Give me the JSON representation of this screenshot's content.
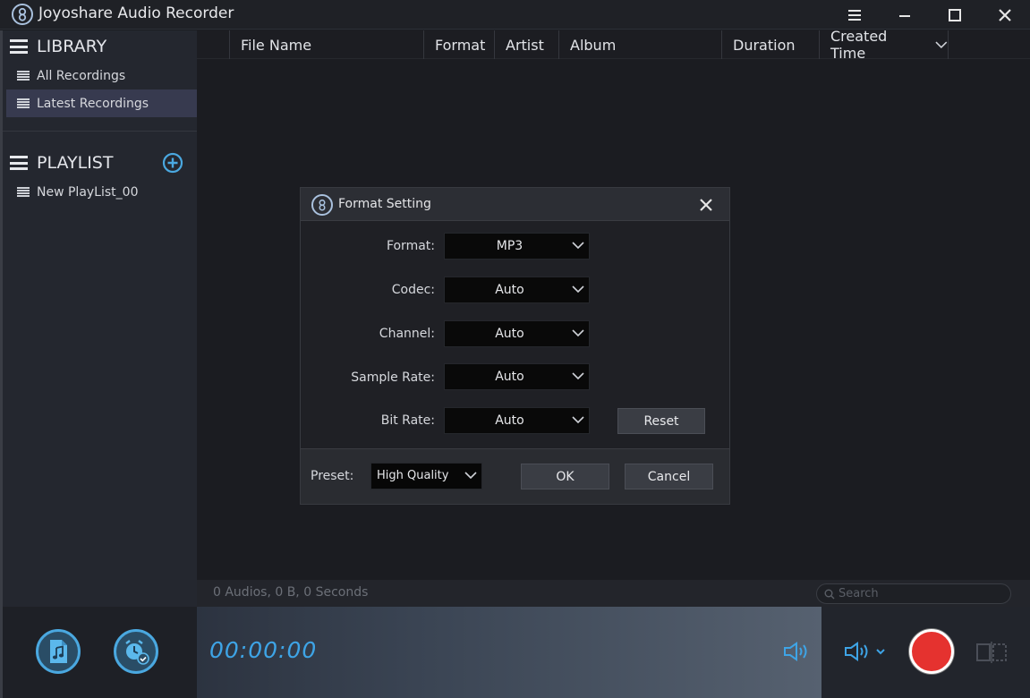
{
  "app": {
    "title": "Joyoshare Audio Recorder"
  },
  "sidebar": {
    "library_title": "LIBRARY",
    "library_items": [
      {
        "label": "All Recordings",
        "active": false
      },
      {
        "label": "Latest Recordings",
        "active": true
      }
    ],
    "playlist_title": "PLAYLIST",
    "playlist_items": [
      {
        "label": "New PlayList_00"
      }
    ]
  },
  "table": {
    "columns": [
      "File Name",
      "Format",
      "Artist",
      "Album",
      "Duration",
      "Created Time"
    ],
    "rows": []
  },
  "status": {
    "summary": "0 Audios, 0 B, 0 Seconds",
    "search_placeholder": "Search"
  },
  "player": {
    "time": "00:00:00"
  },
  "dialog": {
    "title": "Format Setting",
    "fields": [
      {
        "label": "Format:",
        "value": "MP3"
      },
      {
        "label": "Codec:",
        "value": "Auto"
      },
      {
        "label": "Channel:",
        "value": "Auto"
      },
      {
        "label": "Sample Rate:",
        "value": "Auto"
      },
      {
        "label": "Bit Rate:",
        "value": "Auto"
      }
    ],
    "reset_label": "Reset",
    "preset_label": "Preset:",
    "preset_value": "High Quality",
    "ok_label": "OK",
    "cancel_label": "Cancel"
  },
  "colors": {
    "accent_blue": "#3ea4e6",
    "record_red": "#e5322f",
    "active_item": "#373a4f"
  },
  "icons": [
    "app-logo-icon",
    "menu-icon",
    "minimize-icon",
    "maximize-icon",
    "close-icon",
    "list-icon",
    "add-playlist-icon",
    "chevron-down-icon",
    "search-icon",
    "music-file-icon",
    "alarm-schedule-icon",
    "speaker-icon",
    "volume-icon",
    "record-icon",
    "split-view-icon"
  ]
}
